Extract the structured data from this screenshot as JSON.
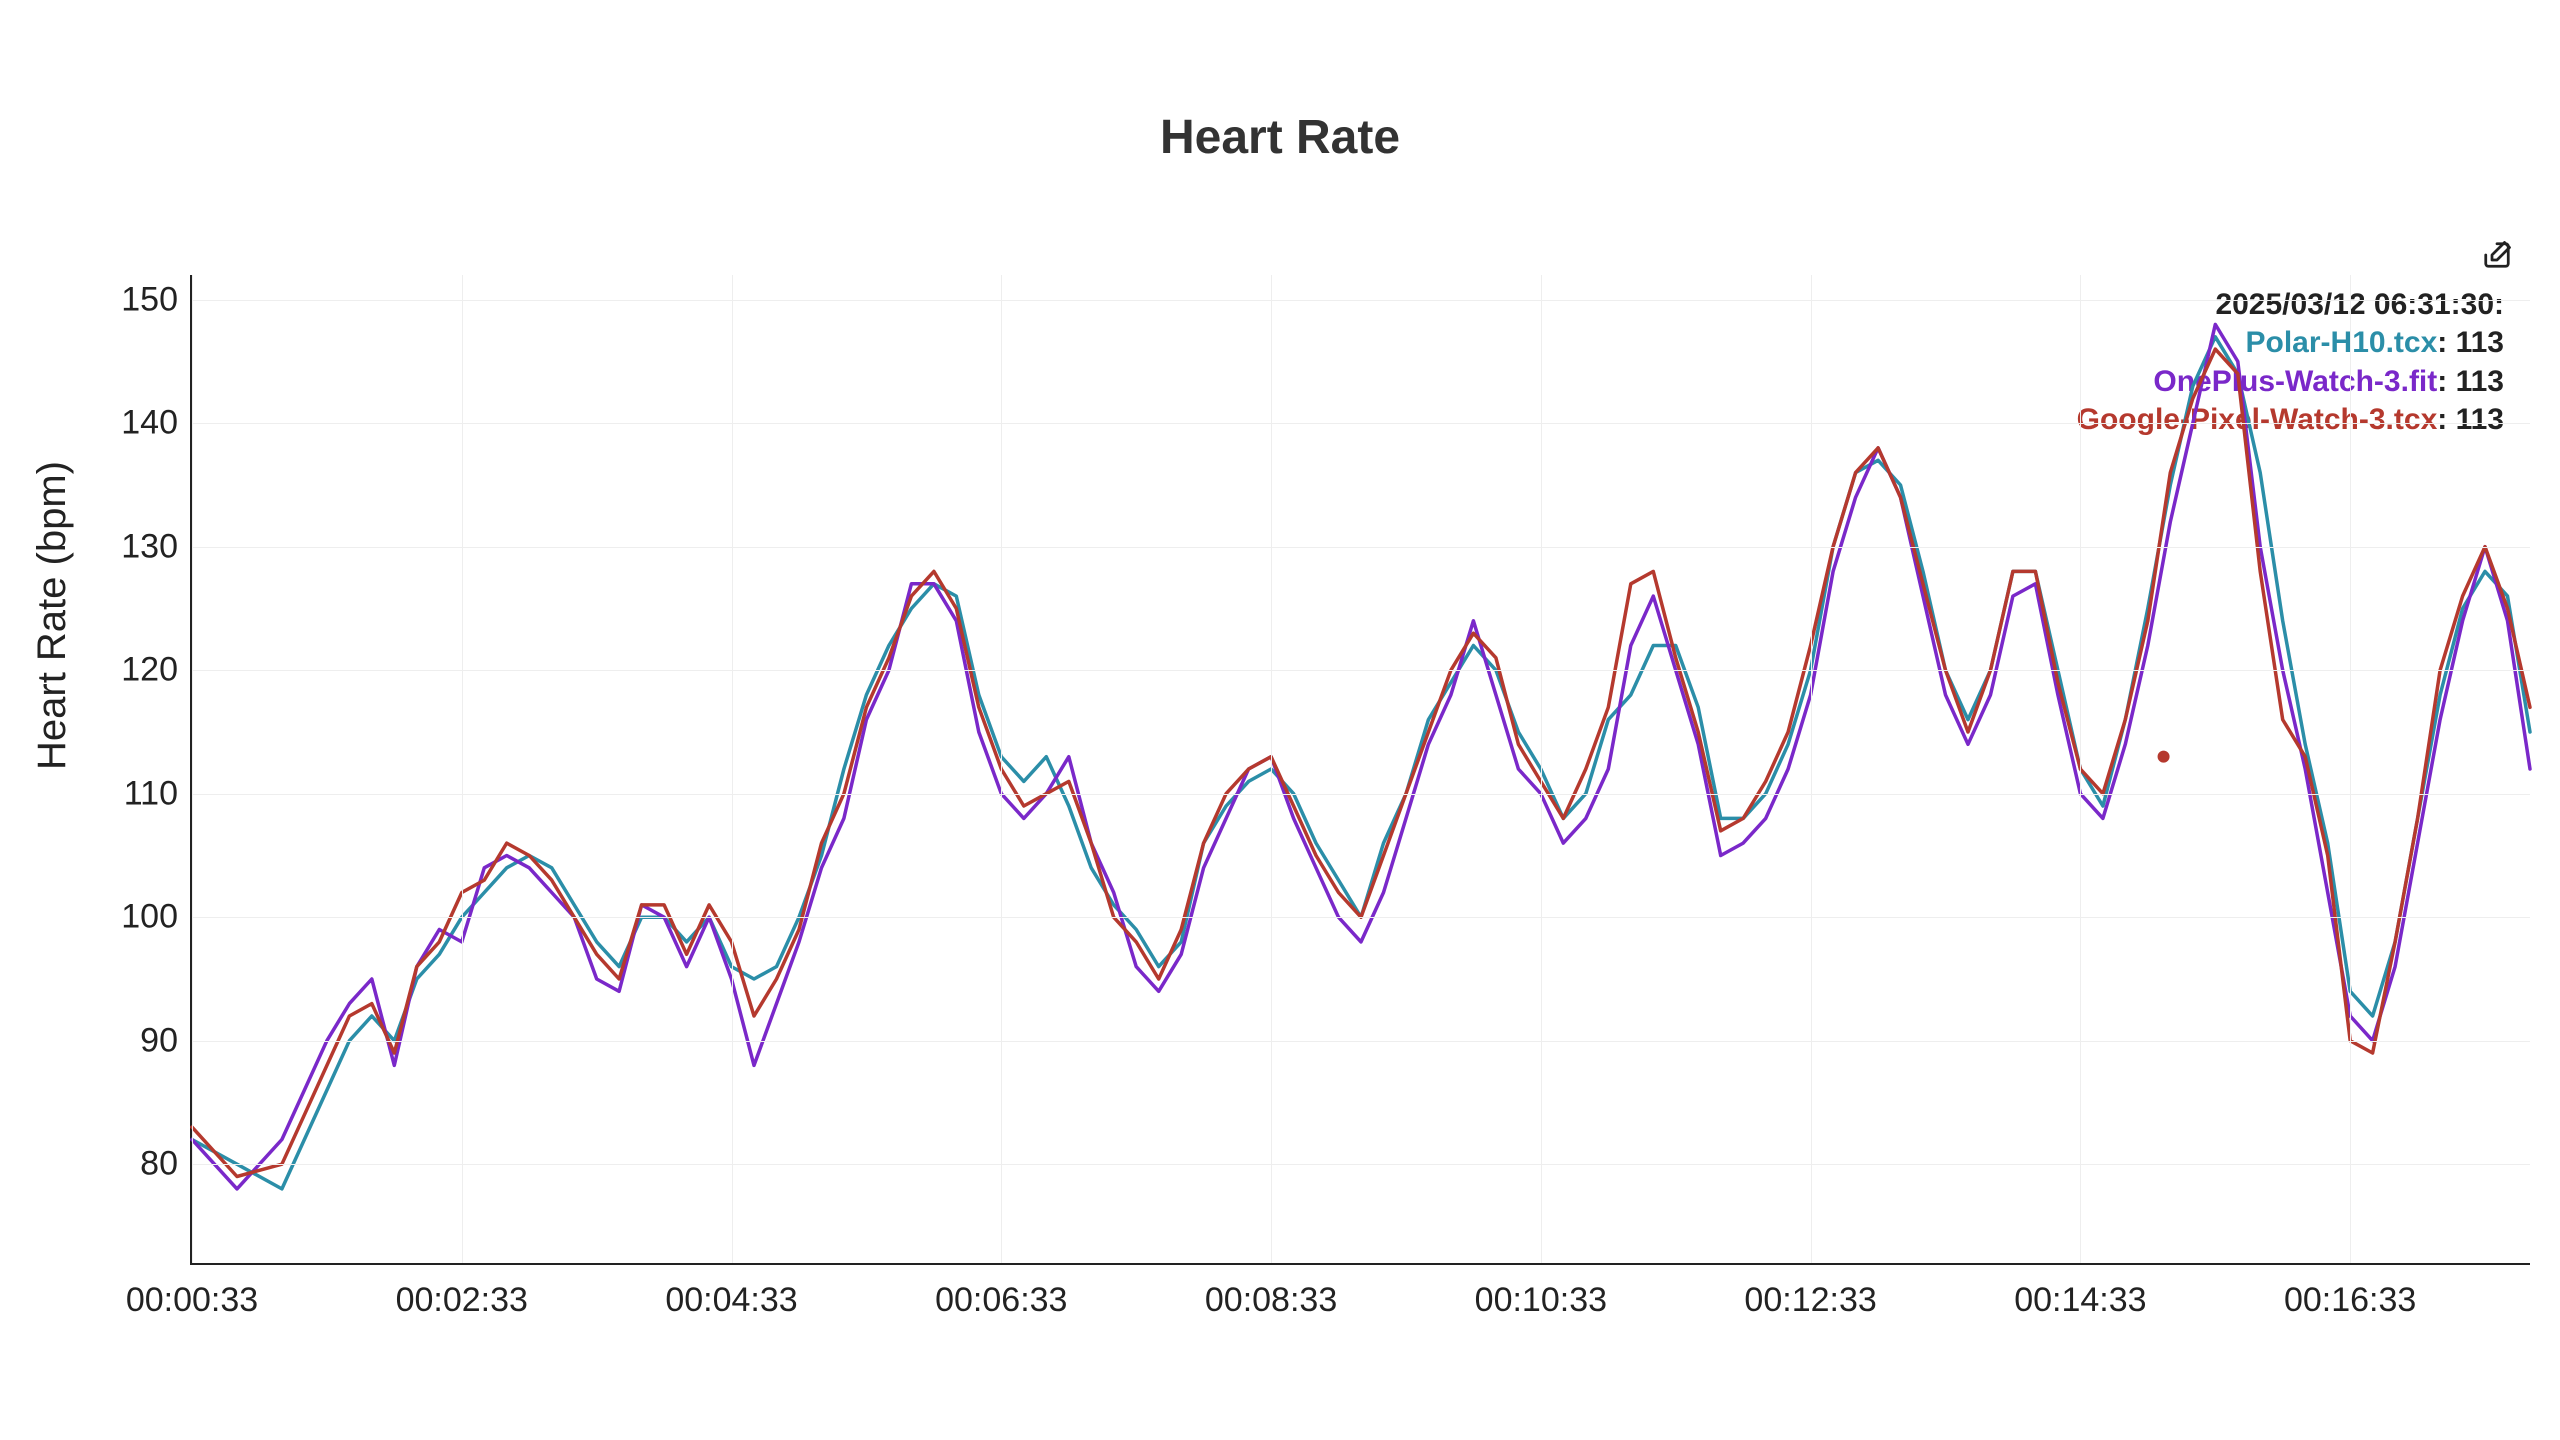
{
  "title": "Heart Rate",
  "ylabel": "Heart Rate (bpm)",
  "hover_timestamp": "2025/03/12 06:31:30:",
  "legend_rows": [
    {
      "name": "Polar-H10.tcx",
      "value": "113",
      "color": "#2B8EA8"
    },
    {
      "name": "OnePlus-Watch-3.fit",
      "value": "113",
      "color": "#7A28C9"
    },
    {
      "name": "Google-Pixel-Watch-3.tcx",
      "value": "113",
      "color": "#B5392E"
    }
  ],
  "colors": {
    "polar": "#2B8EA8",
    "oneplus": "#7A28C9",
    "pixel": "#B5392E"
  },
  "chart_data": {
    "type": "line",
    "title": "Heart Rate",
    "xlabel": "",
    "ylabel": "Heart Rate (bpm)",
    "x_categories": [
      "00:00:33",
      "00:02:33",
      "00:04:33",
      "00:06:33",
      "00:08:33",
      "00:10:33",
      "00:12:33",
      "00:14:33",
      "00:16:33"
    ],
    "x_seconds": [
      33,
      153,
      273,
      393,
      513,
      633,
      753,
      873,
      993
    ],
    "x_range": [
      33,
      1073
    ],
    "ylim": [
      72,
      152
    ],
    "y_ticks": [
      80,
      90,
      100,
      110,
      120,
      130,
      140,
      150
    ],
    "hover_x": 910,
    "series": [
      {
        "name": "Polar-H10.tcx",
        "color": "#2B8EA8",
        "x": [
          33,
          53,
          73,
          83,
          93,
          103,
          113,
          123,
          133,
          143,
          153,
          163,
          173,
          183,
          193,
          203,
          213,
          223,
          233,
          243,
          253,
          263,
          273,
          283,
          293,
          303,
          313,
          323,
          333,
          343,
          353,
          363,
          373,
          383,
          393,
          403,
          413,
          423,
          433,
          443,
          453,
          463,
          473,
          483,
          493,
          503,
          513,
          523,
          533,
          543,
          553,
          563,
          573,
          583,
          593,
          603,
          613,
          623,
          633,
          643,
          653,
          663,
          673,
          683,
          693,
          703,
          713,
          723,
          733,
          743,
          753,
          763,
          773,
          783,
          793,
          803,
          813,
          823,
          833,
          843,
          853,
          863,
          873,
          883,
          893,
          903,
          913,
          923,
          933,
          943,
          953,
          963,
          973,
          983,
          993,
          1003,
          1013,
          1023,
          1033,
          1043,
          1053,
          1063,
          1073
        ],
        "values": [
          82,
          80,
          78,
          82,
          86,
          90,
          92,
          90,
          95,
          97,
          100,
          102,
          104,
          105,
          104,
          101,
          98,
          96,
          100,
          100,
          98,
          100,
          96,
          95,
          96,
          100,
          105,
          112,
          118,
          122,
          125,
          127,
          126,
          118,
          113,
          111,
          113,
          109,
          104,
          101,
          99,
          96,
          98,
          106,
          109,
          111,
          112,
          110,
          106,
          103,
          100,
          106,
          110,
          116,
          119,
          122,
          120,
          115,
          112,
          108,
          110,
          116,
          118,
          122,
          122,
          117,
          108,
          108,
          110,
          114,
          120,
          130,
          136,
          137,
          135,
          128,
          120,
          116,
          120,
          128,
          128,
          120,
          112,
          109,
          116,
          125,
          135,
          143,
          147,
          144,
          136,
          124,
          114,
          106,
          94,
          92,
          98,
          108,
          118,
          125,
          128,
          126,
          115
        ]
      },
      {
        "name": "OnePlus-Watch-3.fit",
        "color": "#7A28C9",
        "x": [
          33,
          53,
          73,
          83,
          93,
          103,
          113,
          123,
          133,
          143,
          153,
          163,
          173,
          183,
          193,
          203,
          213,
          223,
          233,
          243,
          253,
          263,
          273,
          283,
          293,
          303,
          313,
          323,
          333,
          343,
          353,
          363,
          373,
          383,
          393,
          403,
          413,
          423,
          433,
          443,
          453,
          463,
          473,
          483,
          493,
          503,
          513,
          523,
          533,
          543,
          553,
          563,
          573,
          583,
          593,
          603,
          613,
          623,
          633,
          643,
          653,
          663,
          673,
          683,
          693,
          703,
          713,
          723,
          733,
          743,
          753,
          763,
          773,
          783,
          793,
          803,
          813,
          823,
          833,
          843,
          853,
          863,
          873,
          883,
          893,
          903,
          913,
          923,
          933,
          943,
          953,
          963,
          973,
          983,
          993,
          1003,
          1013,
          1023,
          1033,
          1043,
          1053,
          1063,
          1073
        ],
        "values": [
          82,
          78,
          82,
          86,
          90,
          93,
          95,
          88,
          96,
          99,
          98,
          104,
          105,
          104,
          102,
          100,
          95,
          94,
          101,
          100,
          96,
          100,
          95,
          88,
          93,
          98,
          104,
          108,
          116,
          120,
          127,
          127,
          124,
          115,
          110,
          108,
          110,
          113,
          106,
          102,
          96,
          94,
          97,
          104,
          108,
          112,
          113,
          108,
          104,
          100,
          98,
          102,
          108,
          114,
          118,
          124,
          118,
          112,
          110,
          106,
          108,
          112,
          122,
          126,
          120,
          114,
          105,
          106,
          108,
          112,
          118,
          128,
          134,
          138,
          134,
          126,
          118,
          114,
          118,
          126,
          127,
          118,
          110,
          108,
          114,
          122,
          132,
          140,
          148,
          145,
          130,
          120,
          112,
          102,
          92,
          90,
          96,
          106,
          116,
          124,
          130,
          124,
          112
        ]
      },
      {
        "name": "Google-Pixel-Watch-3.tcx",
        "color": "#B5392E",
        "x": [
          33,
          53,
          73,
          83,
          93,
          103,
          113,
          123,
          133,
          143,
          153,
          163,
          173,
          183,
          193,
          203,
          213,
          223,
          233,
          243,
          253,
          263,
          273,
          283,
          293,
          303,
          313,
          323,
          333,
          343,
          353,
          363,
          373,
          383,
          393,
          403,
          413,
          423,
          433,
          443,
          453,
          463,
          473,
          483,
          493,
          503,
          513,
          523,
          533,
          543,
          553,
          563,
          573,
          583,
          593,
          603,
          613,
          623,
          633,
          643,
          653,
          663,
          673,
          683,
          693,
          703,
          713,
          723,
          733,
          743,
          753,
          763,
          773,
          783,
          793,
          803,
          813,
          823,
          833,
          843,
          853,
          863,
          873,
          883,
          893,
          903,
          913,
          923,
          933,
          943,
          953,
          963,
          973,
          983,
          993,
          1003,
          1013,
          1023,
          1033,
          1043,
          1053,
          1063,
          1073
        ],
        "values": [
          83,
          79,
          80,
          84,
          88,
          92,
          93,
          89,
          96,
          98,
          102,
          103,
          106,
          105,
          103,
          100,
          97,
          95,
          101,
          101,
          97,
          101,
          98,
          92,
          95,
          99,
          106,
          110,
          117,
          121,
          126,
          128,
          125,
          117,
          112,
          109,
          110,
          111,
          106,
          100,
          98,
          95,
          99,
          106,
          110,
          112,
          113,
          109,
          105,
          102,
          100,
          105,
          110,
          115,
          120,
          123,
          121,
          114,
          111,
          108,
          112,
          117,
          127,
          128,
          121,
          115,
          107,
          108,
          111,
          115,
          122,
          130,
          136,
          138,
          134,
          127,
          120,
          115,
          120,
          128,
          128,
          119,
          112,
          110,
          116,
          124,
          136,
          142,
          146,
          144,
          128,
          116,
          113,
          105,
          90,
          89,
          98,
          108,
          120,
          126,
          130,
          125,
          117
        ]
      }
    ]
  }
}
